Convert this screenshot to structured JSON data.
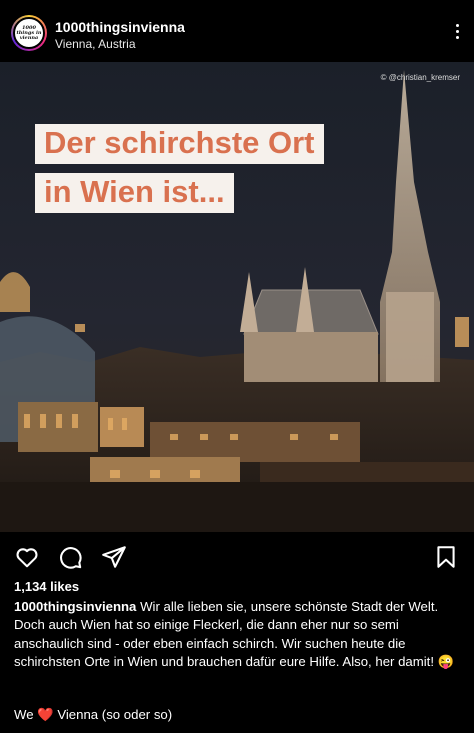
{
  "header": {
    "avatar_text": "1000 things in vienna",
    "username": "1000thingsinvienna",
    "location": "Vienna, Austria"
  },
  "post": {
    "photo_credit": "© @christian_kremser",
    "headline_line1": "Der schirchste Ort",
    "headline_line2": "in Wien ist..."
  },
  "actions": {
    "icons": [
      "heart-icon",
      "comment-icon",
      "share-icon",
      "bookmark-icon"
    ]
  },
  "likes": "1,134 likes",
  "caption": {
    "username": "1000thingsinvienna",
    "text": "Wir alle lieben sie, unsere schönste Stadt der Welt. Doch auch Wien hat so einige Fleckerl, die dann eher nur so semi anschaulich sind - oder eben einfach schirch. Wir suchen heute die schirchsten Orte in Wien und brauchen dafür eure Hilfe. Also, her damit! 😜",
    "tagline_start": "We",
    "tagline_heart": "❤️",
    "tagline_end": "Vienna (so oder so)"
  },
  "colors": {
    "headline_text": "#d9714f",
    "headline_bg": "#f6f1ec",
    "background": "#000000"
  }
}
